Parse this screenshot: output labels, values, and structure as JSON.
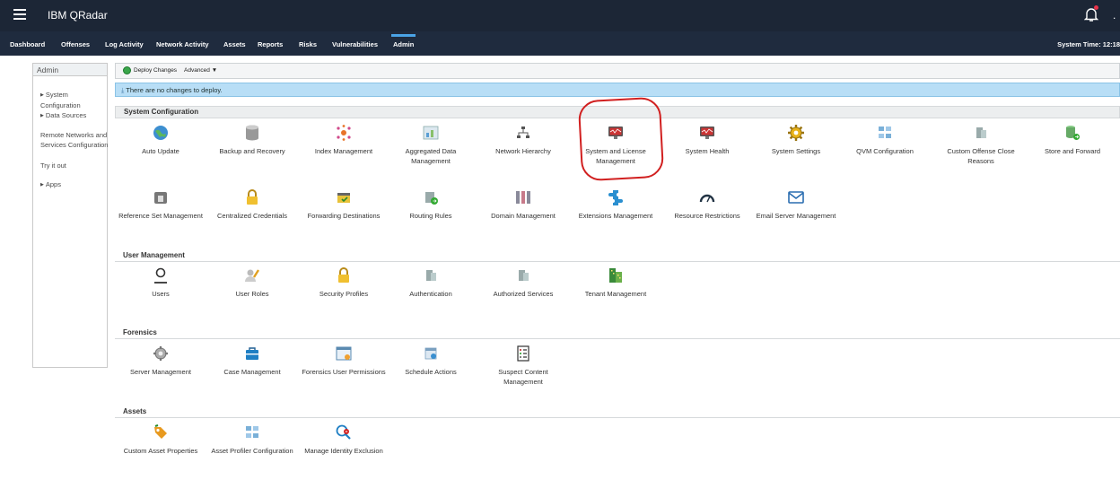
{
  "app": {
    "title": "IBM QRadar",
    "system_time": "System Time: 12:18"
  },
  "nav": {
    "tabs": [
      {
        "label": "Dashboard"
      },
      {
        "label": "Offenses"
      },
      {
        "label": "Log Activity"
      },
      {
        "label": "Network Activity"
      },
      {
        "label": "Assets"
      },
      {
        "label": "Reports"
      },
      {
        "label": "Risks"
      },
      {
        "label": "Vulnerabilities"
      },
      {
        "label": "Admin"
      }
    ],
    "active_tab": "Admin"
  },
  "sidebar": {
    "title": "Admin",
    "items": [
      {
        "label": "System Configuration"
      },
      {
        "label": "Data Sources"
      },
      {
        "label": "Remote Networks and Services Configuration"
      },
      {
        "label": "Try it out"
      },
      {
        "label": "Apps"
      }
    ]
  },
  "toolbar": {
    "deploy_label": "Deploy Changes",
    "advanced_label": "Advanced ▼"
  },
  "notice": {
    "text": "There are no changes to deploy."
  },
  "sections": {
    "system_configuration": {
      "title": "System Configuration",
      "tiles": [
        {
          "label": "Auto Update",
          "icon": "globe-update-icon"
        },
        {
          "label": "Backup and Recovery",
          "icon": "database-icon"
        },
        {
          "label": "Index Management",
          "icon": "index-icon"
        },
        {
          "label": "Aggregated Data Management",
          "icon": "data-chart-icon"
        },
        {
          "label": "Network Hierarchy",
          "icon": "network-hierarchy-icon"
        },
        {
          "label": "System and License Management",
          "icon": "monitor-icon"
        },
        {
          "label": "System Health",
          "icon": "health-monitor-icon"
        },
        {
          "label": "System Settings",
          "icon": "gear-icon"
        },
        {
          "label": "QVM Configuration",
          "icon": "qvm-icon"
        },
        {
          "label": "Custom Offense Close Reasons",
          "icon": "servers-icon"
        },
        {
          "label": "Store and Forward",
          "icon": "store-forward-icon"
        },
        {
          "label": "Reference Set Management",
          "icon": "reference-set-icon"
        },
        {
          "label": "Centralized Credentials",
          "icon": "lock-icon"
        },
        {
          "label": "Forwarding Destinations",
          "icon": "forwarding-icon"
        },
        {
          "label": "Routing Rules",
          "icon": "routing-icon"
        },
        {
          "label": "Domain Management",
          "icon": "domain-icon"
        },
        {
          "label": "Extensions Management",
          "icon": "puzzle-icon"
        },
        {
          "label": "Resource Restrictions",
          "icon": "gauge-icon"
        },
        {
          "label": "Email Server Management",
          "icon": "mail-icon"
        }
      ]
    },
    "user_management": {
      "title": "User Management",
      "tiles": [
        {
          "label": "Users",
          "icon": "user-icon"
        },
        {
          "label": "User Roles",
          "icon": "user-roles-icon"
        },
        {
          "label": "Security Profiles",
          "icon": "lock-icon"
        },
        {
          "label": "Authentication",
          "icon": "servers-icon"
        },
        {
          "label": "Authorized Services",
          "icon": "servers-icon"
        },
        {
          "label": "Tenant Management",
          "icon": "building-icon"
        }
      ]
    },
    "forensics": {
      "title": "Forensics",
      "tiles": [
        {
          "label": "Server Management",
          "icon": "server-gear-icon"
        },
        {
          "label": "Case Management",
          "icon": "briefcase-icon"
        },
        {
          "label": "Forensics User Permissions",
          "icon": "permissions-icon"
        },
        {
          "label": "Schedule Actions",
          "icon": "calendar-icon"
        },
        {
          "label": "Suspect Content Management",
          "icon": "checklist-icon"
        }
      ]
    },
    "assets": {
      "title": "Assets",
      "tiles": [
        {
          "label": "Custom Asset Properties",
          "icon": "tag-icon"
        },
        {
          "label": "Asset Profiler Configuration",
          "icon": "profiler-icon"
        },
        {
          "label": "Manage Identity Exclusion",
          "icon": "identity-exclusion-icon"
        }
      ]
    }
  },
  "colors": {
    "topbar": "#1c2636",
    "navbar": "#1f2b3e",
    "active_tab": "#4aa3e6",
    "notice_bg": "#b8def6",
    "highlight": "#d12020"
  }
}
